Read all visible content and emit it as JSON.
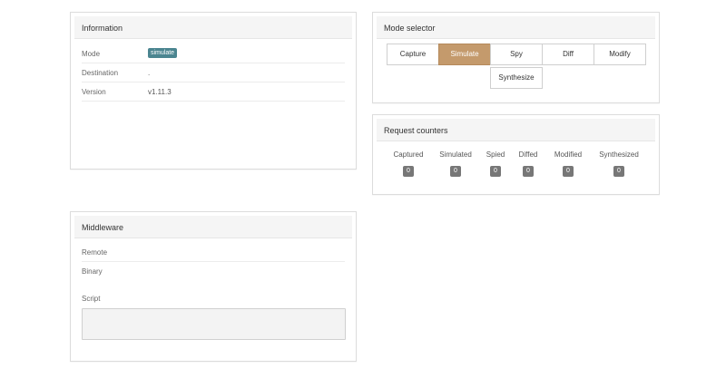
{
  "information": {
    "title": "Information",
    "rows": [
      {
        "label": "Mode",
        "value": "simulate"
      },
      {
        "label": "Destination",
        "value": "."
      },
      {
        "label": "Version",
        "value": "v1.11.3"
      }
    ],
    "badge_color": "#4b8590"
  },
  "mode_selector": {
    "title": "Mode selector",
    "buttons": [
      "Capture",
      "Simulate",
      "Spy",
      "Diff",
      "Modify",
      "Synthesize"
    ],
    "active": "Simulate",
    "active_color": "#c49a6c"
  },
  "request_counters": {
    "title": "Request counters",
    "counters": [
      {
        "label": "Captured",
        "value": "0"
      },
      {
        "label": "Simulated",
        "value": "0"
      },
      {
        "label": "Spied",
        "value": "0"
      },
      {
        "label": "Diffed",
        "value": "0"
      },
      {
        "label": "Modified",
        "value": "0"
      },
      {
        "label": "Synthesized",
        "value": "0"
      }
    ]
  },
  "middleware": {
    "title": "Middleware",
    "remote_label": "Remote",
    "binary_label": "Binary",
    "script_label": "Script",
    "script_value": ""
  }
}
